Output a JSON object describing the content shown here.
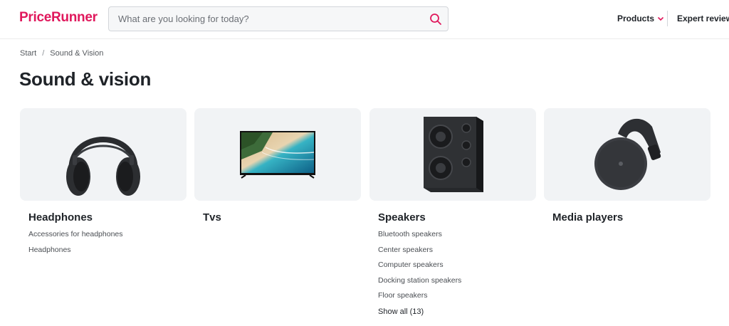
{
  "header": {
    "logo": "PriceRunner",
    "search_placeholder": "What are you looking for today?",
    "nav_products": "Products",
    "nav_expert_reviews": "Expert reviews"
  },
  "breadcrumb": {
    "start": "Start",
    "separator": "/",
    "current": "Sound & Vision"
  },
  "page_title": "Sound & vision",
  "colors": {
    "brand": "#e0185c",
    "card_bg": "#f1f3f5"
  },
  "categories": [
    {
      "title": "Headphones",
      "image": "headphones-image",
      "subcategories": [
        "Accessories for headphones",
        "Headphones"
      ]
    },
    {
      "title": "Tvs",
      "image": "tv-image",
      "subcategories": []
    },
    {
      "title": "Speakers",
      "image": "speaker-image",
      "subcategories": [
        "Bluetooth speakers",
        "Center speakers",
        "Computer speakers",
        "Docking station speakers",
        "Floor speakers"
      ],
      "show_all": "Show all (13)"
    },
    {
      "title": "Media players",
      "image": "media-player-image",
      "subcategories": []
    }
  ]
}
